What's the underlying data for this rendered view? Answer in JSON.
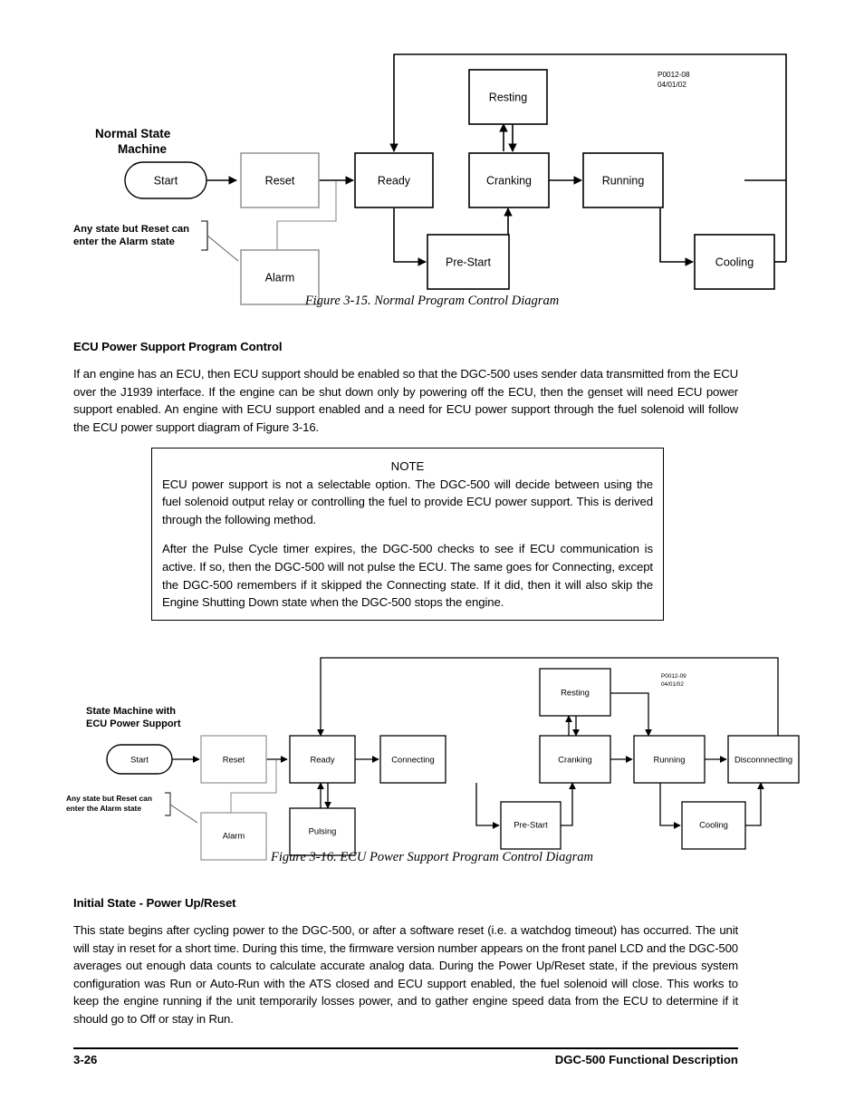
{
  "figure1": {
    "title_line1": "Normal State",
    "title_line2": "Machine",
    "drawing_id": "P0012-08",
    "drawing_date": "04/01/02",
    "callout_line1": "Any state but Reset can",
    "callout_line2": "enter the Alarm state",
    "nodes": {
      "start": "Start",
      "reset": "Reset",
      "ready": "Ready",
      "alarm": "Alarm",
      "resting": "Resting",
      "cranking": "Cranking",
      "running": "Running",
      "prestart": "Pre-Start",
      "cooling": "Cooling"
    },
    "caption": "Figure 3-15. Normal Program Control Diagram"
  },
  "figure2": {
    "title_line1": "State Machine with",
    "title_line2": "ECU Power Support",
    "drawing_id": "P0012-09",
    "drawing_date": "04/01/02",
    "callout_line1": "Any state but Reset can",
    "callout_line2": "enter the Alarm state",
    "nodes": {
      "start": "Start",
      "reset": "Reset",
      "ready": "Ready",
      "connecting": "Connecting",
      "alarm": "Alarm",
      "pulsing": "Pulsing",
      "resting": "Resting",
      "cranking": "Cranking",
      "running": "Running",
      "disconnecting": "Disconnnecting",
      "prestart": "Pre-Start",
      "cooling": "Cooling"
    },
    "caption": "Figure 3-16. ECU Power Support Program Control Diagram"
  },
  "sections": {
    "ecu_heading": "ECU Power Support Program Control",
    "ecu_paragraph": "If an engine has an ECU, then ECU support should be enabled so that the DGC-500 uses sender data transmitted from the ECU over the J1939 interface. If the engine can be shut down only by powering off the ECU, then the genset will need ECU power support enabled. An engine with ECU support enabled and a need for ECU power support through the fuel solenoid will follow the ECU power support diagram of Figure 3-16.",
    "initial_heading": "Initial State - Power Up/Reset",
    "initial_paragraph": "This state begins after cycling power to the DGC-500, or after a software reset (i.e. a watchdog timeout) has occurred. The unit will stay in reset for a short time. During this time, the firmware version number appears on the front panel LCD and the DGC-500 averages out enough data counts to calculate accurate analog data. During the Power Up/Reset state, if the previous system configuration was Run or Auto-Run with the ATS closed and ECU support enabled, the fuel solenoid will close. This works to keep the engine running if the unit temporarily losses power, and to gather engine speed data from the ECU to determine if it should go to Off or stay in Run."
  },
  "note": {
    "title": "NOTE",
    "paragraph1": "ECU power support is not a selectable option. The DGC-500 will decide between using the fuel solenoid output relay or controlling the fuel to provide ECU power support. This is derived through the following method.",
    "paragraph2": "After the Pulse Cycle timer expires, the DGC-500 checks to see if ECU communication is active. If so, then the DGC-500 will not pulse the ECU. The same goes for Connecting, except the DGC-500 remembers if it skipped the Connecting state.  If it did, then it will also skip the Engine Shutting Down state when the DGC-500 stops the engine."
  },
  "footer": {
    "page_number": "3-26",
    "document_title": "DGC-500 Functional Description"
  }
}
